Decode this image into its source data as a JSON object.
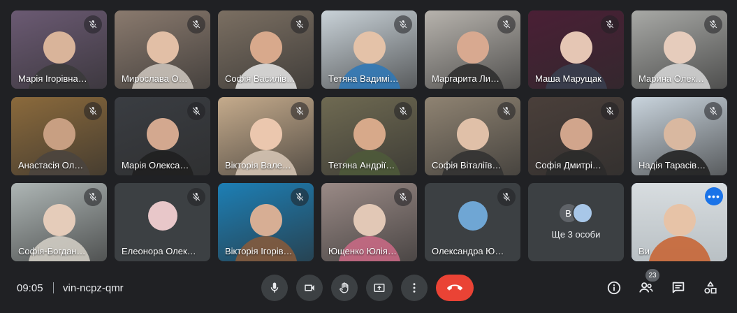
{
  "participants": [
    {
      "name": "Марія Ігорівна…",
      "bg": "#6b5a73",
      "skin": "#d9b49a",
      "shirt": "#3a3a3a"
    },
    {
      "name": "Мирослава О…",
      "bg": "#8a7a6e",
      "skin": "#e2bfa6",
      "shirt": "#cfc8c0"
    },
    {
      "name": "Софія Василів…",
      "bg": "#7b6f62",
      "skin": "#d8a98c",
      "shirt": "#e8e8e8"
    },
    {
      "name": "Тетяна Вадимі…",
      "bg": "#c9d2d8",
      "skin": "#e4c2a8",
      "shirt": "#2d78b8"
    },
    {
      "name": "Маргарита Ли…",
      "bg": "#b7b3ad",
      "skin": "#d8a990",
      "shirt": "#2c2c2c"
    },
    {
      "name": "Маша Марущак",
      "bg": "#4a1f35",
      "skin": "#e5c6b4",
      "shirt": "#3a4150"
    },
    {
      "name": "Марина Олек…",
      "bg": "#a8a9a6",
      "skin": "#e6ccbc",
      "shirt": "#d8d8d8"
    },
    {
      "name": "Анастасія Ол…",
      "bg": "#8b6a3c",
      "skin": "#c89f82",
      "shirt": "#4a4440"
    },
    {
      "name": "Марія Олекса…",
      "bg": "#3a3d42",
      "skin": "#d3a88f",
      "shirt": "#1f1f1f"
    },
    {
      "name": "Вікторія Вале…",
      "bg": "#c5ab8c",
      "skin": "#ebc7ae",
      "shirt": "#d9c9b8"
    },
    {
      "name": "Тетяна Андрії…",
      "bg": "#6f6a52",
      "skin": "#d7a98a",
      "shirt": "#4e5a3a"
    },
    {
      "name": "Софія Віталіїв…",
      "bg": "#8f8372",
      "skin": "#e0c0a8",
      "shirt": "#303030"
    },
    {
      "name": "Софія Дмитрі…",
      "bg": "#4a3f3a",
      "skin": "#d1a58c",
      "shirt": "#2a2a2a"
    },
    {
      "name": "Надія Тарасів…",
      "bg": "#c9d4dd",
      "skin": "#d9b8a0",
      "shirt": "#1f1f1f"
    },
    {
      "name": "Софія-Богдан…",
      "bg": "#aeb6b5",
      "skin": "#e5ccba",
      "shirt": "#d6d1c8"
    },
    {
      "name": "Елеонора Олек…",
      "bg": "#3c4043",
      "avatar": "#e8c7c9"
    },
    {
      "name": "Вікторія Ігорів…",
      "bg": "#1d7fb5",
      "skin": "#d7ae94",
      "shirt": "#8a5a3a"
    },
    {
      "name": "Ющенко Юлія…",
      "bg": "#9a8a86",
      "skin": "#e2c8b6",
      "shirt": "#cc6a86"
    },
    {
      "name": "Олександра Ю…",
      "bg": "#3c4043",
      "avatar": "#6fa6d4"
    }
  ],
  "more": {
    "label": "Ще 3 особи",
    "initial": "В"
  },
  "self_tile": {
    "name": "Ви",
    "options_icon": "more-horiz-icon"
  },
  "bottom_bar": {
    "time": "09:05",
    "meeting_code": "vin-ncpz-qmr",
    "participants_count": "23"
  },
  "icons": {
    "mute": "mic-off-icon",
    "mic": "mic-icon",
    "camera": "videocam-icon",
    "hand": "raise-hand-icon",
    "present": "present-screen-icon",
    "more": "more-vert-icon",
    "hangup": "call-end-icon",
    "info": "info-icon",
    "people": "people-icon",
    "chat": "chat-icon",
    "activities": "activities-icon"
  },
  "colors": {
    "background": "#202124",
    "hangup": "#ea4335",
    "accent": "#8ab4f8",
    "tile": "#3c4043"
  }
}
